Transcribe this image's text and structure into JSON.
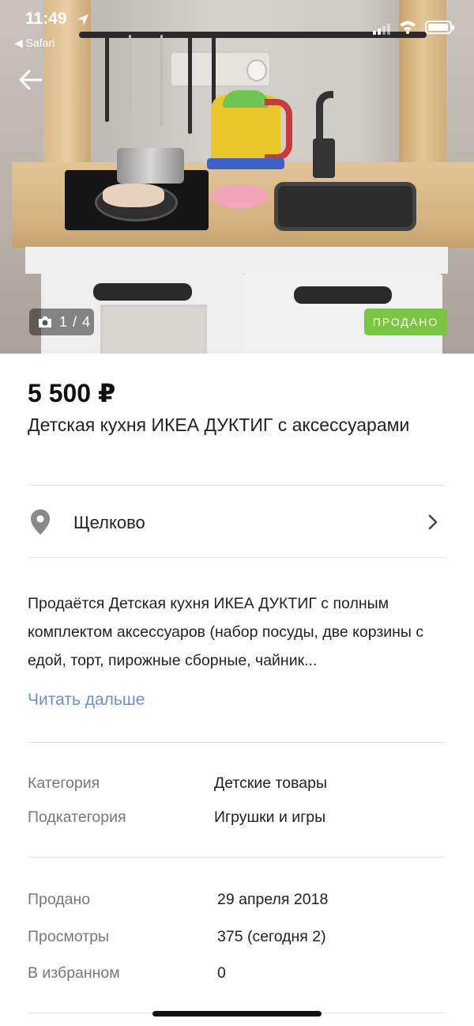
{
  "status_bar": {
    "time": "11:49",
    "back_app": "◀ Safari"
  },
  "photo": {
    "counter": "1 / 4",
    "badge": "ПРОДАНО"
  },
  "listing": {
    "price": "5 500 ₽",
    "title": "Детская кухня ИКЕА ДУКТИГ с аксессуарами",
    "location": "Щелково",
    "description": "Продаётся Детская кухня ИКЕА ДУКТИГ с полным комплектом аксессуаров (набор посуды, две корзины с едой, торт, пирожные сборные, чайник...",
    "read_more": "Читать дальше"
  },
  "details": [
    {
      "label": "Категория",
      "value": "Детские товары"
    },
    {
      "label": "Подкатегория",
      "value": "Игрушки и игры"
    }
  ],
  "stats": [
    {
      "label": "Продано",
      "value": "29 апреля 2018"
    },
    {
      "label": "Просмотры",
      "value": "375 (сегодня 2)"
    },
    {
      "label": "В избранном",
      "value": "0"
    }
  ],
  "colors": {
    "sold_badge": "#7ac642",
    "link": "#6b8fd6"
  }
}
